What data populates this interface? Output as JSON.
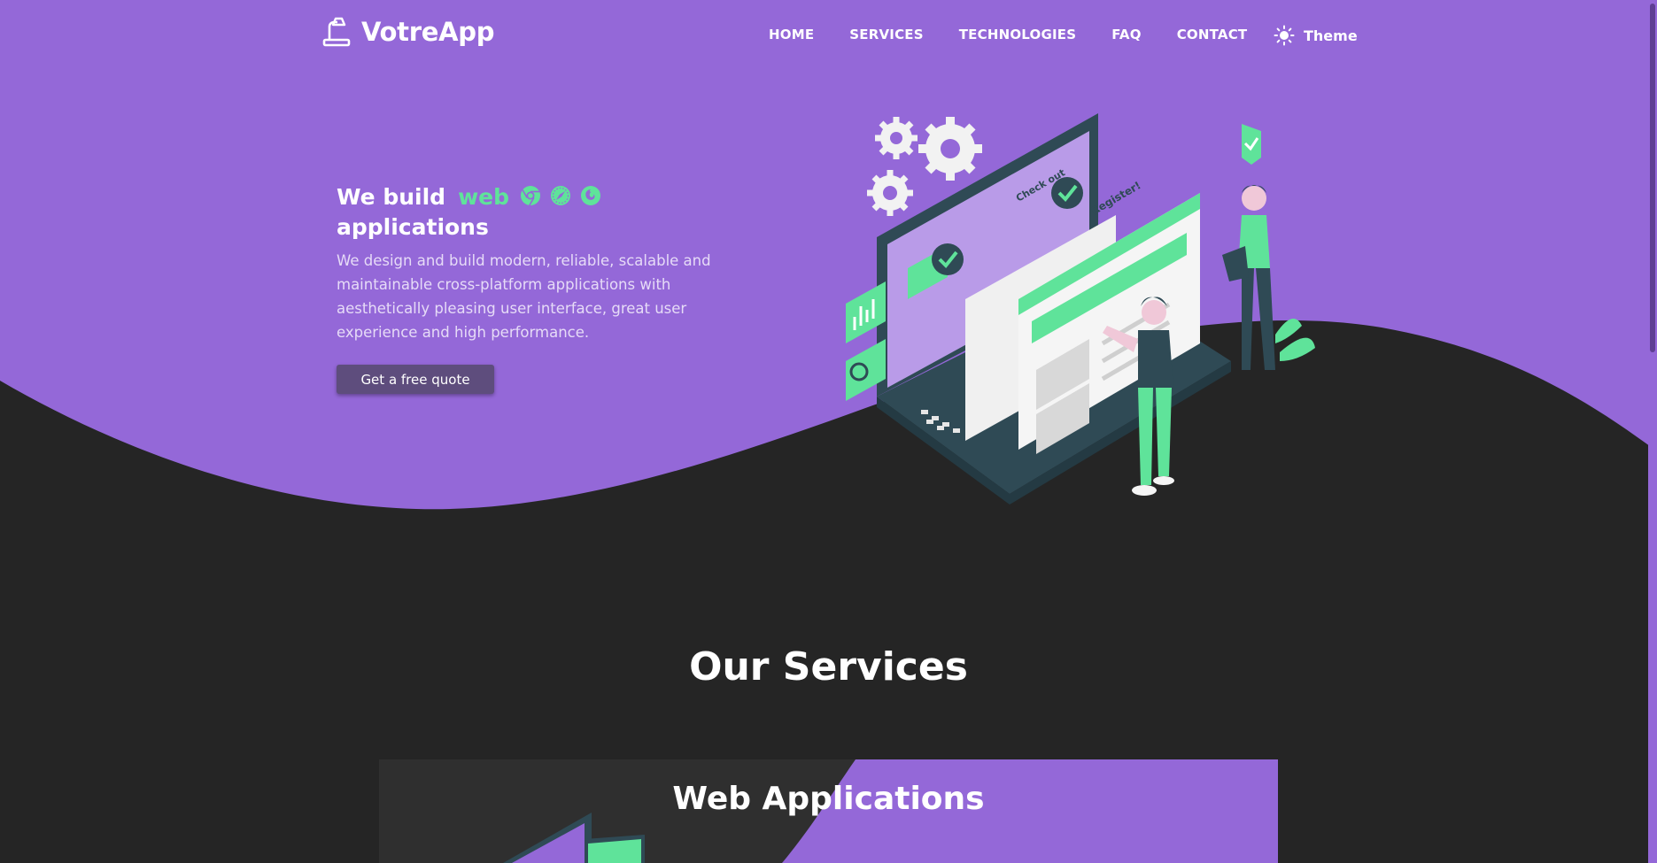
{
  "brand": {
    "name": "VotreApp",
    "icon": "desk-lamp-logo-icon"
  },
  "nav": {
    "items": [
      {
        "label": "HOME"
      },
      {
        "label": "SERVICES"
      },
      {
        "label": "TECHNOLOGIES"
      },
      {
        "label": "FAQ"
      },
      {
        "label": "CONTACT"
      }
    ],
    "theme_label": "Theme",
    "theme_icon": "sun-icon"
  },
  "hero": {
    "title_part1": "We build",
    "title_accent": "web",
    "title_part2": "applications",
    "browser_icons": [
      "chrome-icon",
      "safari-icon",
      "firefox-icon"
    ],
    "description": "We design and build modern, reliable, scalable and maintainable cross-platform applications with aesthetically pleasing user interface, great user experience and high performance.",
    "cta_label": "Get a free quote"
  },
  "illustration": {
    "register_text": "Register!",
    "check_out_text": "Check out"
  },
  "services": {
    "title": "Our Services",
    "cards": [
      {
        "title": "Web Applications"
      }
    ]
  },
  "colors": {
    "primary": "#9468d8",
    "accent": "#5fe39a",
    "dark_bg": "#252525",
    "card_bg": "#2f2f2f",
    "button": "#5e4d7d"
  }
}
